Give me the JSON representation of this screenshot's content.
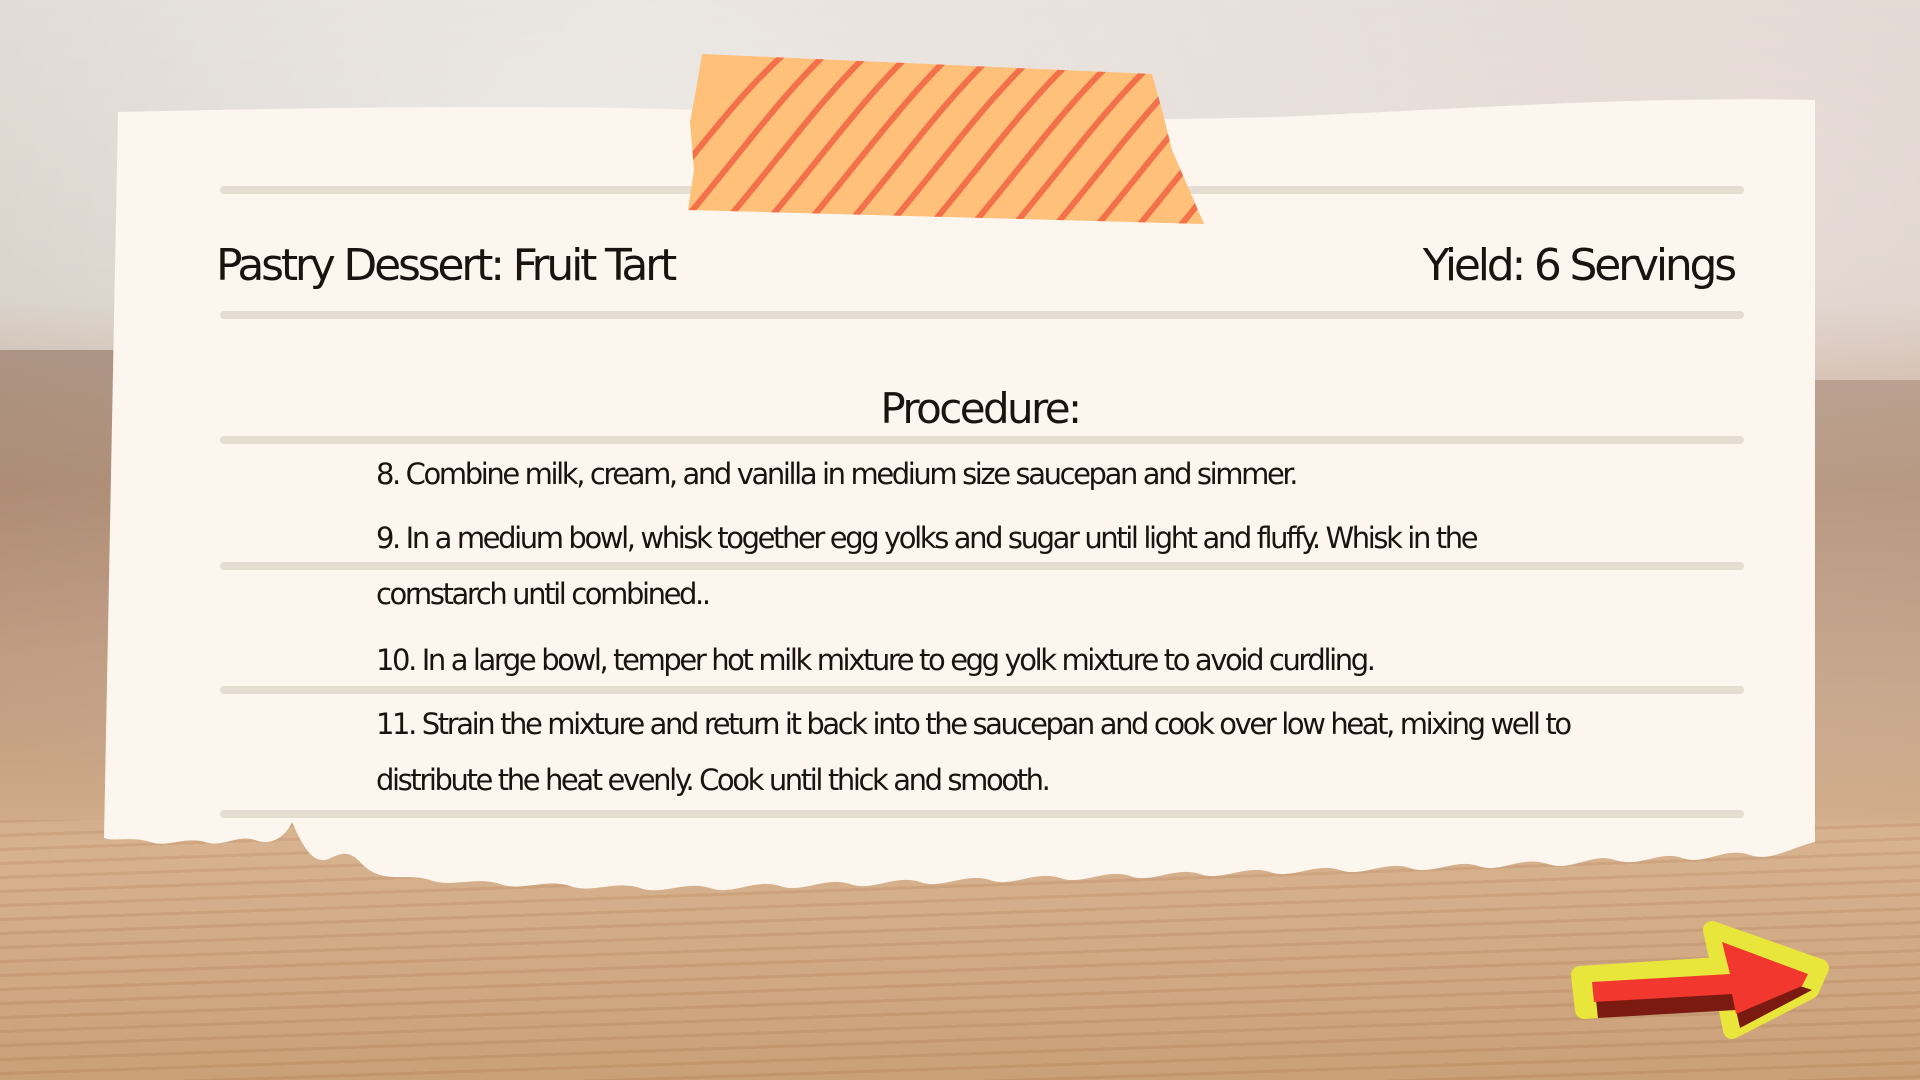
{
  "recipe": {
    "title": "Pastry Dessert: Fruit Tart",
    "yield": "Yield: 6 Servings"
  },
  "procedure": {
    "heading": "Procedure:",
    "steps": [
      "8. Combine milk, cream, and vanilla in medium size saucepan and simmer.",
      "9. In a medium bowl, whisk together egg yolks and sugar until light and fluffy. Whisk in the cornstarch until combined..",
      "10. In a large bowl, temper hot milk mixture to egg yolk mixture to avoid curdling.",
      "11. Strain the mixture and return it back into the saucepan and cook over low heat, mixing well to distribute the heat evenly. Cook until thick and smooth."
    ]
  },
  "colors": {
    "paper": "#fdf6ee",
    "rule": "#e5dcd2",
    "tape_base": "#ffc07a",
    "tape_stripe": "#f2704a",
    "arrow_fill": "#f2372f",
    "arrow_outline": "#e8e63a",
    "arrow_shadow": "#7a1a10"
  },
  "icons": {
    "next": "arrow-right-icon"
  }
}
